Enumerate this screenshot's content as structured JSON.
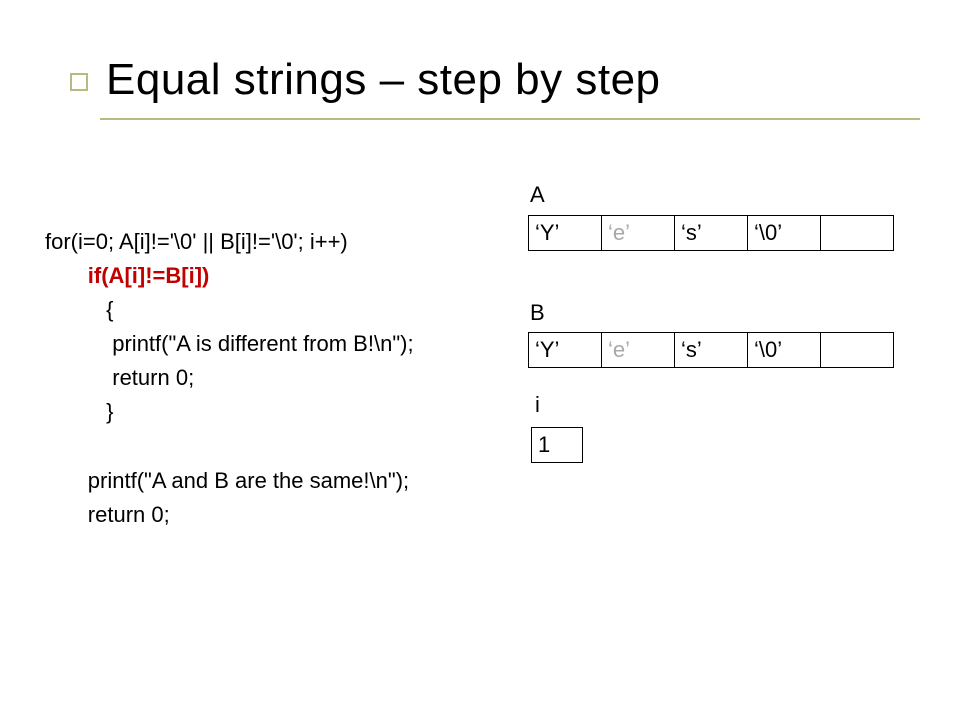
{
  "title": "Equal strings – step by step",
  "code": {
    "l1": "for(i=0; A[i]!='\\0' || B[i]!='\\0'; i++)",
    "l2": "if(A[i]!=B[i])",
    "l3": "{",
    "l4": "printf(\"A is different from B!\\n\");",
    "l5": "return 0;",
    "l6": "}",
    "l7": "",
    "l8": "printf(\"A and B are the same!\\n\");",
    "l9": "return 0;"
  },
  "labels": {
    "A": "A",
    "B": "B",
    "i": "i"
  },
  "arrays": {
    "A": [
      "‘Y’",
      "‘e’",
      "‘s’",
      "‘\\0’",
      ""
    ],
    "B": [
      "‘Y’",
      "‘e’",
      "‘s’",
      "‘\\0’",
      ""
    ]
  },
  "current_index": 1,
  "i_value": "1"
}
